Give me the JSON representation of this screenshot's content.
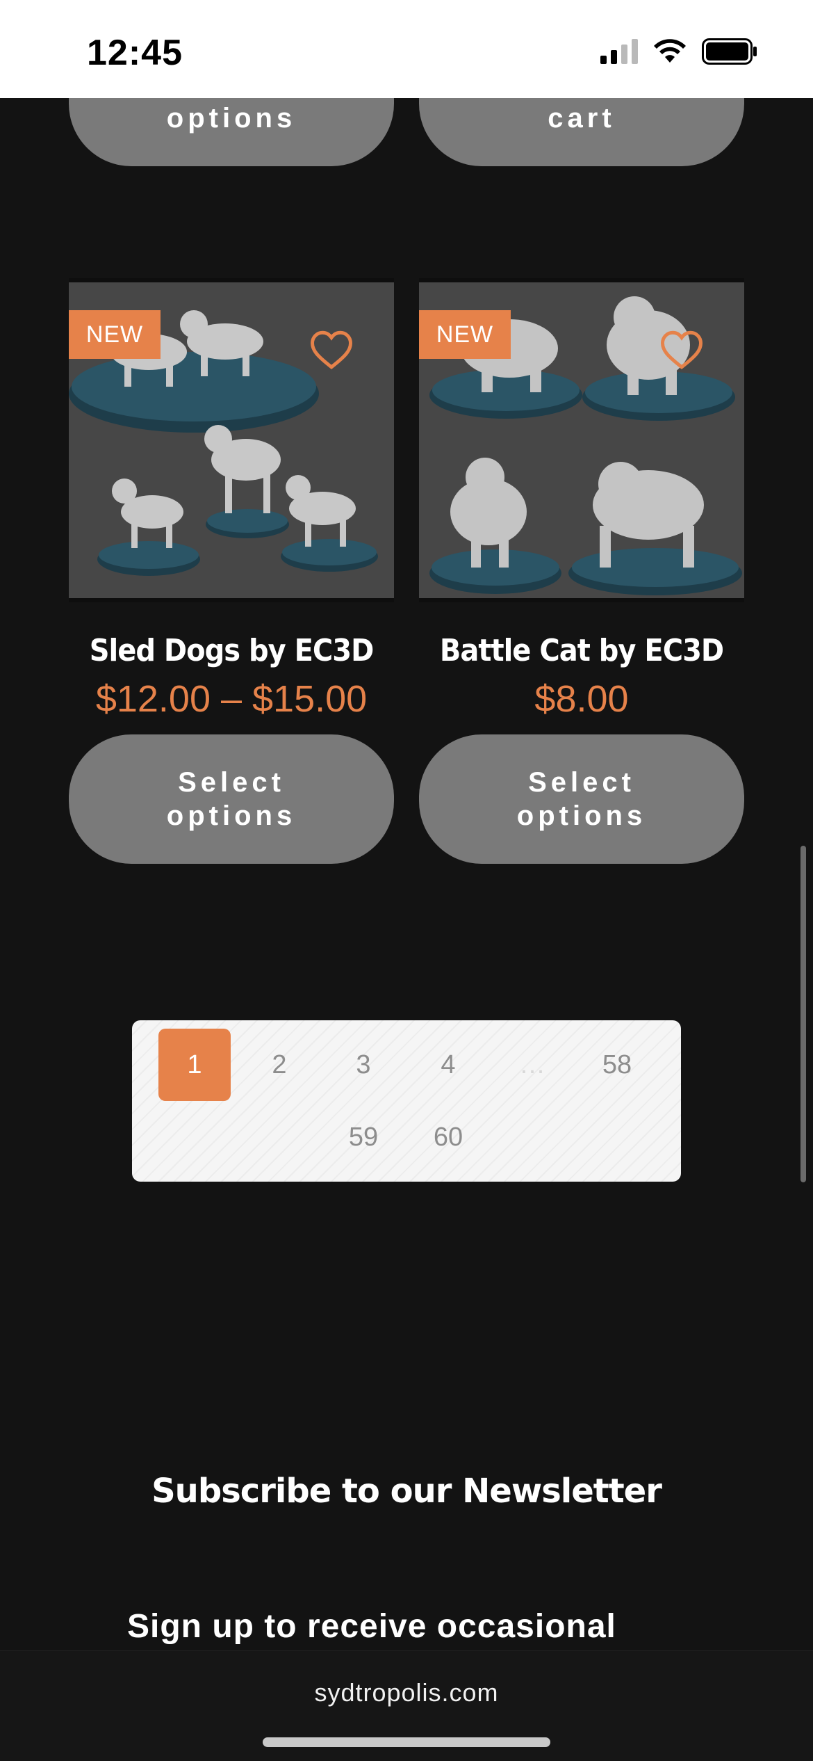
{
  "status_bar": {
    "time": "12:45"
  },
  "top_buttons": [
    {
      "label": "Select\noptions"
    },
    {
      "label": "Add to\ncart"
    }
  ],
  "products": [
    {
      "badge": "NEW",
      "title": "Sled Dogs by EC3D",
      "price": "$12.00 – $15.00",
      "button": "Select\noptions",
      "image_icon": "sled-dogs-image"
    },
    {
      "badge": "NEW",
      "title": "Battle Cat by EC3D",
      "price": "$8.00",
      "button": "Select\noptions",
      "image_icon": "battle-cat-image"
    }
  ],
  "pagination": {
    "pages": [
      "1",
      "2",
      "3",
      "4",
      "…",
      "58",
      "59",
      "60"
    ],
    "current": "1"
  },
  "newsletter": {
    "title": "Subscribe to our Newsletter",
    "text": "Sign up to receive occasional"
  },
  "browser": {
    "url": "sydtropolis.com"
  },
  "colors": {
    "accent": "#e6824a",
    "background": "#131313",
    "button": "#7a7a7a"
  }
}
